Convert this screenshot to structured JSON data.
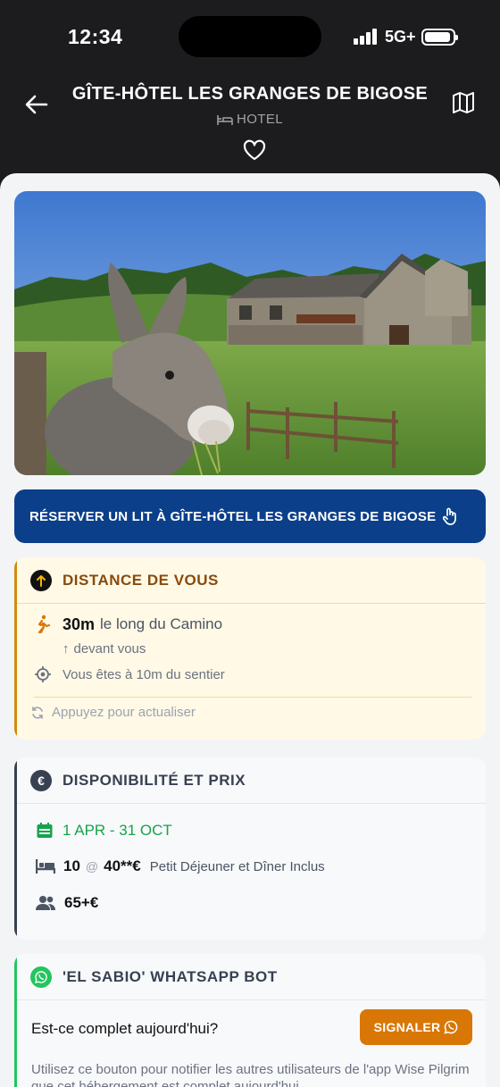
{
  "status_bar": {
    "time": "12:34",
    "network": "5G+"
  },
  "header": {
    "title": "GÎTE-HÔTEL LES GRANGES DE BIGOSE",
    "type_label": "HOTEL"
  },
  "photo": {
    "description_icon": "photo-donkey-farmhouse"
  },
  "booking": {
    "label": "RÉSERVER UN LIT À GÎTE-HÔTEL LES GRANGES DE BIGOSE"
  },
  "distance": {
    "title": "DISTANCE DE VOUS",
    "distance_value": "30m",
    "distance_suffix": "le long du Camino",
    "direction": "devant vous",
    "off_trail": "Vous êtes à 10m du sentier",
    "refresh": "Appuyez pour actualiser"
  },
  "availability": {
    "title": "DISPONIBILITÉ ET PRIX",
    "dates": "1 APR - 31 OCT",
    "beds": "10",
    "at": "@",
    "price": "40**€",
    "price_note": "Petit Déjeuner et Dîner Inclus",
    "group_price": "65+€"
  },
  "whatsapp": {
    "title": "'EL SABIO' WHATSAPP BOT",
    "question": "Est-ce complet aujourd'hui?",
    "report_label": "SIGNALER",
    "help_text": "Utilisez ce bouton pour notifier les autres utilisateurs de l'app Wise Pilgrim que cet hébergement est complet aujourd'hui"
  },
  "colors": {
    "booking_bg": "#0b3f8a",
    "distance_accent": "#d08a0c",
    "distance_title": "#8a4a0a",
    "availability_accent": "#374151",
    "dates_green": "#16a34a",
    "whatsapp_green": "#22c55e",
    "report_orange": "#d97706"
  }
}
